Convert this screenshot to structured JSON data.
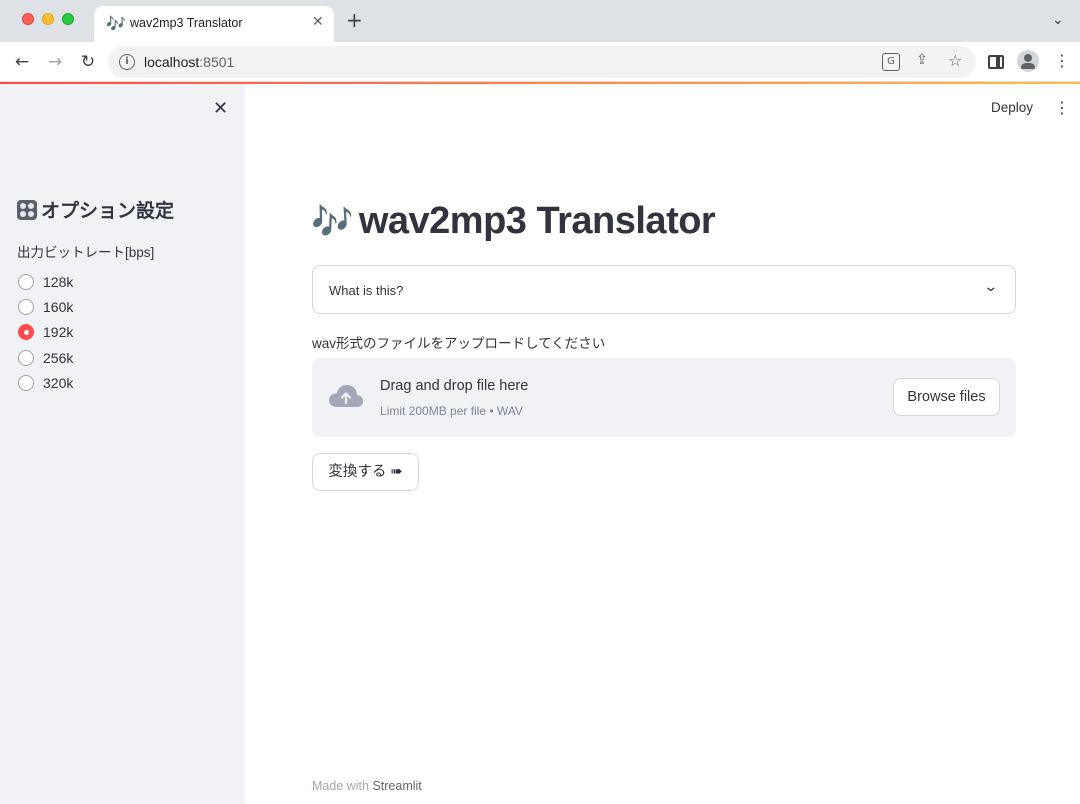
{
  "browser": {
    "tab_title": "wav2mp3 Translator",
    "tab_icon": "🎶",
    "url_host": "localhost",
    "url_port": ":8501"
  },
  "header": {
    "deploy_label": "Deploy"
  },
  "sidebar": {
    "heading": "オプション設定",
    "bitrate_label": "出力ビットレート[bps]",
    "bitrate_options": [
      "128k",
      "160k",
      "192k",
      "256k",
      "320k"
    ],
    "selected_bitrate": "192k"
  },
  "main": {
    "title": "wav2mp3 Translator",
    "title_icon": "🎶",
    "expander_label": "What is this?",
    "upload_label": "wav形式のファイルをアップロードしてください",
    "dropzone_title": "Drag and drop file here",
    "dropzone_subtitle": "Limit 200MB per file • WAV",
    "browse_label": "Browse files",
    "convert_label": "変換する ➠"
  },
  "footer": {
    "prefix": "Made with ",
    "brand": "Streamlit"
  },
  "colors": {
    "accent": "#ff4b4b",
    "sidebar_bg": "#f0f2f6",
    "text": "#31333f"
  }
}
